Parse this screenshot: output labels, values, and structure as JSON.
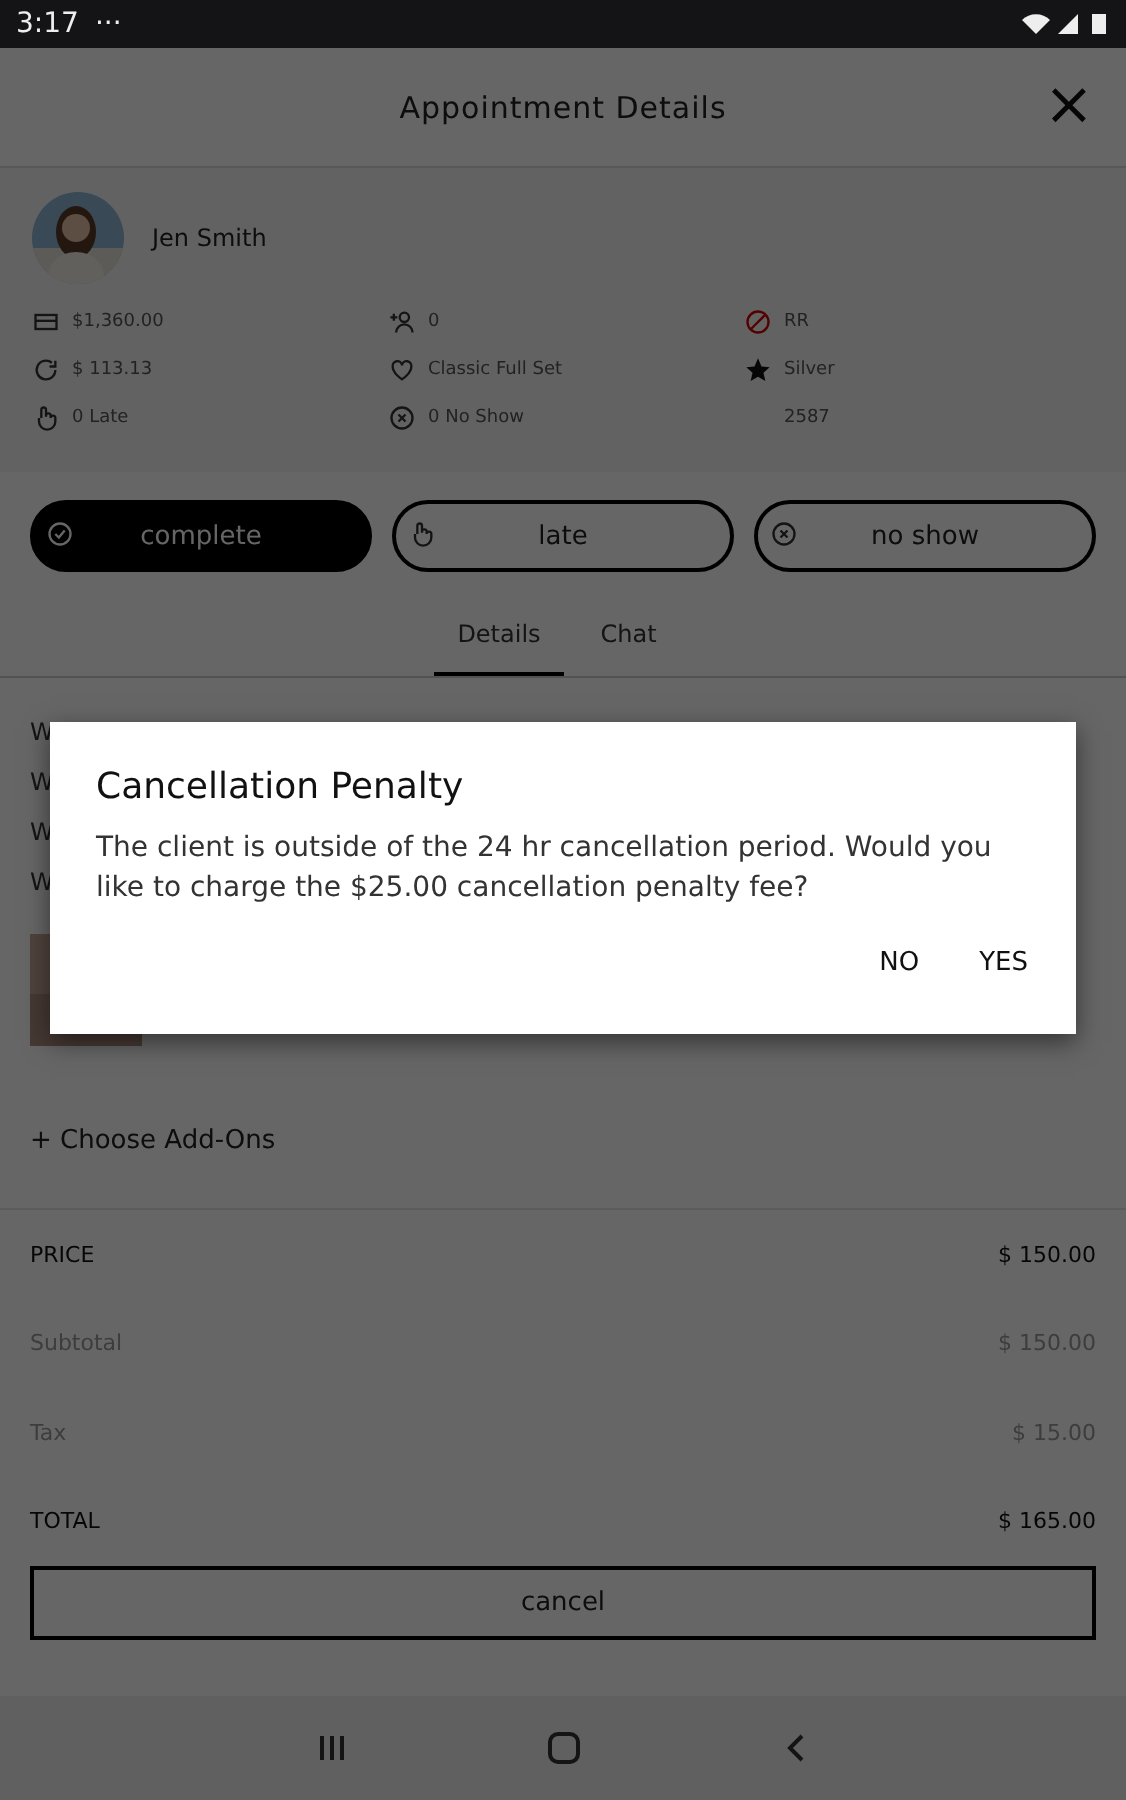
{
  "status_bar": {
    "time": "3:17",
    "more": "···"
  },
  "header": {
    "title": "Appointment Details",
    "close": "×"
  },
  "client": {
    "name": "Jen Smith"
  },
  "stats": [
    {
      "kind": "card",
      "text": "$1,360.00"
    },
    {
      "kind": "person-add",
      "text": "0"
    },
    {
      "kind": "ban",
      "text": "RR"
    },
    {
      "kind": "refresh",
      "text": "$ 113.13"
    },
    {
      "kind": "heart",
      "text": "Classic Full Set"
    },
    {
      "kind": "star",
      "text": "Silver"
    },
    {
      "kind": "hand",
      "text": "0 Late"
    },
    {
      "kind": "x-circle",
      "text": "0 No Show"
    },
    {
      "kind": "none",
      "text": "2587"
    }
  ],
  "status_buttons": [
    {
      "kind": "check",
      "label": "complete",
      "selected": true
    },
    {
      "kind": "hand",
      "label": "late",
      "selected": false
    },
    {
      "kind": "x-circle",
      "label": "no show",
      "selected": false
    }
  ],
  "tabs": [
    {
      "label": "Details",
      "selected": true
    },
    {
      "label": "Chat",
      "selected": false
    }
  ],
  "detail_rows": [
    "W",
    "W",
    "W",
    "W"
  ],
  "add_ons": {
    "label": "+ Choose Add-Ons"
  },
  "totals": [
    {
      "kind": "strong",
      "label": "PRICE",
      "value": "$ 150.00"
    },
    {
      "kind": "muted",
      "label": "Subtotal",
      "value": "$ 150.00"
    },
    {
      "kind": "muted",
      "label": "Tax",
      "value": "$ 15.00"
    },
    {
      "kind": "strong",
      "label": "TOTAL",
      "value": "$ 165.00"
    }
  ],
  "cancel_button": "cancel",
  "dialog": {
    "title": "Cancellation Penalty",
    "message": "The client is outside of the 24 hr cancellation period. Would you like to charge the $25.00 cancellation penalty fee?",
    "buttons": [
      "NO",
      "YES"
    ]
  }
}
